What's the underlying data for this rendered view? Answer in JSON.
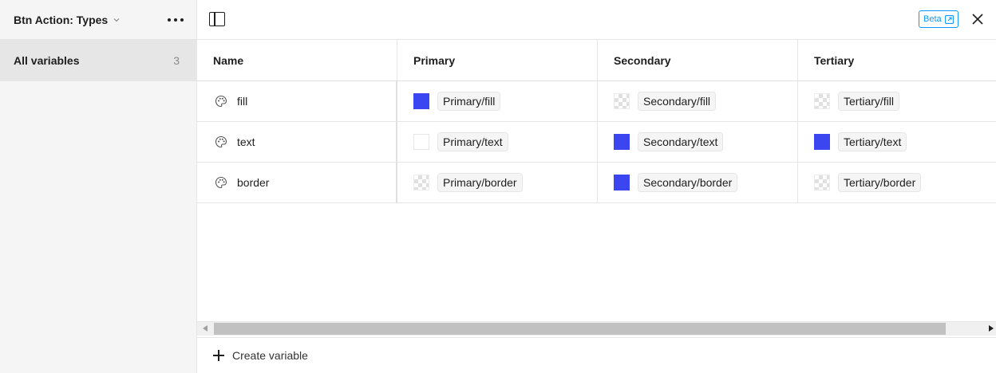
{
  "sidebar": {
    "collection_title": "Btn Action: Types",
    "items": [
      {
        "label": "All variables",
        "count": "3"
      }
    ]
  },
  "topbar": {
    "beta_label": "Beta"
  },
  "table": {
    "columns": [
      "Name",
      "Primary",
      "Secondary",
      "Tertiary"
    ],
    "rows": [
      {
        "name": "fill",
        "values": [
          {
            "alias": "Primary/fill",
            "swatch": "#3b46f1"
          },
          {
            "alias": "Secondary/fill",
            "swatch": "transparent"
          },
          {
            "alias": "Tertiary/fill",
            "swatch": "transparent"
          }
        ]
      },
      {
        "name": "text",
        "values": [
          {
            "alias": "Primary/text",
            "swatch": "#ffffff"
          },
          {
            "alias": "Secondary/text",
            "swatch": "#3b46f1"
          },
          {
            "alias": "Tertiary/text",
            "swatch": "#3b46f1"
          }
        ]
      },
      {
        "name": "border",
        "values": [
          {
            "alias": "Primary/border",
            "swatch": "transparent"
          },
          {
            "alias": "Secondary/border",
            "swatch": "#3b46f1"
          },
          {
            "alias": "Tertiary/border",
            "swatch": "transparent"
          }
        ]
      }
    ]
  },
  "footer": {
    "create_label": "Create variable"
  },
  "colors": {
    "accent": "#0d99ff",
    "swatch_blue": "#3b46f1"
  }
}
